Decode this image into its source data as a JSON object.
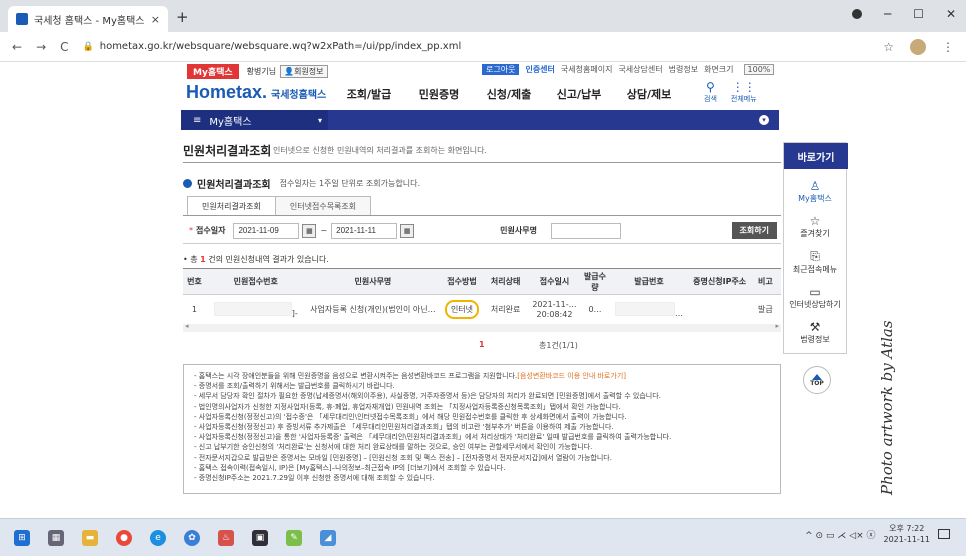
{
  "browser": {
    "tab_title": "국세청 홈택스 - My홈택스",
    "tab_close": "×",
    "new_tab": "+",
    "url": "hometax.go.kr/websquare/websquare.wq?w2xPath=/ui/pp/index_pp.xml",
    "nav_back": "←",
    "nav_forward": "→",
    "nav_reload": "C",
    "star": "☆",
    "menu": "⋮",
    "win_min": "─",
    "win_max": "☐",
    "win_close": "✕"
  },
  "topline": {
    "badge": "My홈택스",
    "user": "황병기님",
    "user_info_btn": "👤회원정보",
    "logout": "로그아웃",
    "cert_center": "인증센터",
    "links": [
      "국세청홈페이지",
      "국세상담센터",
      "법령정보",
      "화면크기"
    ],
    "zoom": "100%"
  },
  "gnb": {
    "logo": "Hometax.",
    "logo_sub": "국세청홈택스",
    "menu": [
      "조회/발급",
      "민원증명",
      "신청/제출",
      "신고/납부",
      "상담/제보"
    ],
    "search": "검색",
    "all_menu": "전체메뉴"
  },
  "subnav": {
    "current": "My홈택스",
    "menu_icon": "≡",
    "dropdown": "▾",
    "circle_icon": "▾"
  },
  "page": {
    "title": "민원처리결과조회",
    "description": "인터넷으로 신청한 민원내역의 처리결과를 조회하는 화면입니다.",
    "section_title": "민원처리결과조회",
    "section_desc": "접수일자는 1주일 단위로 조회가능합니다.",
    "tabs": [
      "민원처리결과조회",
      "인터넷접수목록조회"
    ],
    "search": {
      "required_mark": "*",
      "date_label": "접수일자",
      "date_from": "2021-11-09",
      "date_to": "2021-11-11",
      "tilde": "~",
      "office_label": "민원사무명",
      "office_value": "",
      "search_button": "조회하기"
    },
    "result_count": {
      "prefix": "• 총",
      "count": "1",
      "suffix": "건의 민원신청내역 결과가 있습니다."
    },
    "grid": {
      "headers": [
        "번호",
        "민원접수번호",
        "민원사무명",
        "접수방법",
        "처리상태",
        "접수일시",
        "발급수량",
        "발급번호",
        "증명신청IP주소",
        "비고"
      ],
      "rows": [
        {
          "no": "1",
          "receipt_no": "]-",
          "office": "사업자등록 신청(개인)(법인이 아닌…",
          "method": "인터넷",
          "status": "처리완료",
          "datetime": "2021-11-…\n20:08:42",
          "qty": "0…",
          "issue_no": "…",
          "ip": "",
          "note": "발급"
        }
      ]
    },
    "paging": {
      "current": "1",
      "total": "총1건(1/1)"
    },
    "notes": [
      {
        "text": "- 홈택스는 시각 장애인분들을 위해 민원증명을 음성으로 변환시켜주는 음성변환바코드 프로그램을 지원합니다.",
        "highlight": "[음성변환바코드 이용 안내 바로가기]"
      },
      {
        "text": "- 증명서를 조회/출력하기 위해서는 발급번호를 클릭하시기 바랍니다.",
        "highlight": ""
      },
      {
        "text": "- 세무서 담당자 확인 절차가 필요한 증명(납세증명서(해외이주용), 사실증명, 거주자증명서 등)은 담당자의 처리가 완료되면 [민원증명]에서 출력할 수 있습니다.",
        "highlight": ""
      },
      {
        "text": "- 법인명의사업자가 신청한 지정사업자(등록, 휴·폐업, 휴업자재개업) 민원내역 조회는 「지정사업자등록증신청목록조회」탭에서 확인 가능합니다.",
        "highlight": ""
      },
      {
        "text": "- 사업자등록신청(정정신고)의 '접수증'은 「세무대리인\\인터넷접수목록조회」에서 해당 민원접수번호를 클릭한 후 상세화면에서 출력이 가능합니다.",
        "highlight": ""
      },
      {
        "text": "- 사업자등록신청(정정신고) 후 증빙서류 추가제출은 「세무대리인민원처리결과조회」탭의 비고란 '첨부추가' 버튼을 이용하여 제출 가능합니다.",
        "highlight": ""
      },
      {
        "text": "- 사업자등록신청(정정신고)을 통한 '사업자등록증' 출력은 「세무대리인\\민원처리결과조회」에서 처리상태가 '처리완료' 일때 발급번호를 클릭하여 출력가능합니다.",
        "highlight": ""
      },
      {
        "text": "- 신고 납부기한 승인신청의 '처리완료'는 신청서에 대한 처리 완료상태를 말하는 것으로, 승인 여부는 관할세무서에서 확인이 가능합니다.",
        "highlight": ""
      },
      {
        "text": "- 전자문서지갑으로 발급받은 증명서는 모바일 [민원증명] – [민원신청 조회 및 팩스 전송] – [전자증명서 전자문서지갑]에서 열람이 가능합니다.",
        "highlight": ""
      },
      {
        "text": "- 홈택스 접속이력(접속일시, IP)은 [My홈택스]–나의정보–최근접속 IP의 [더보기]에서 조회할 수 있습니다.",
        "highlight": ""
      },
      {
        "text": "- 증명신청IP주소는 2021.7.29일 이후 신청한 증명서에 대해 조회할 수 있습니다.",
        "highlight": ""
      }
    ]
  },
  "quick": {
    "title": "바로가기",
    "items": [
      "My홈택스",
      "즐겨찾기",
      "최근접속메뉴",
      "인터넷상담하기",
      "법령정보"
    ],
    "top": "TOP"
  },
  "watermark": "Photo artwork by Atlas",
  "taskbar": {
    "time": "오후 7:22",
    "date": "2021-11-11",
    "tray_icons": "^ ⊙ ▭ ⋌ ◁× ⓧ"
  }
}
